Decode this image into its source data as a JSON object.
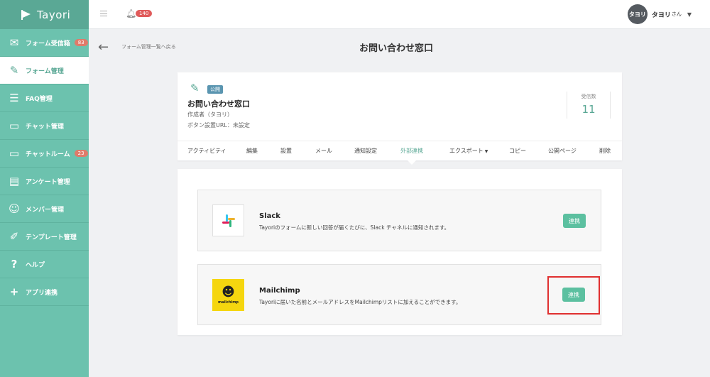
{
  "app": {
    "name": "Tayori"
  },
  "sidebar": {
    "items": [
      {
        "label": "フォーム受信箱",
        "badge": "83",
        "icon": "inbox-icon",
        "glyph": "✉"
      },
      {
        "label": "フォーム管理",
        "badge": "",
        "icon": "form-edit-icon",
        "glyph": "✎"
      },
      {
        "label": "FAQ管理",
        "badge": "",
        "icon": "faq-icon",
        "glyph": "☰"
      },
      {
        "label": "チャット管理",
        "badge": "",
        "icon": "chat-icon",
        "glyph": "▭"
      },
      {
        "label": "チャットルーム",
        "badge": "23",
        "icon": "chat-room-icon",
        "glyph": "▭"
      },
      {
        "label": "アンケート管理",
        "badge": "",
        "icon": "survey-icon",
        "glyph": "▤"
      },
      {
        "label": "メンバー管理",
        "badge": "",
        "icon": "members-icon",
        "glyph": "☺"
      },
      {
        "label": "テンプレート管理",
        "badge": "",
        "icon": "template-icon",
        "glyph": "✐"
      },
      {
        "label": "ヘルプ",
        "badge": "",
        "icon": "help-icon",
        "glyph": "?"
      },
      {
        "label": "アプリ連携",
        "badge": "",
        "icon": "app-integration-icon",
        "glyph": "+"
      }
    ]
  },
  "topbar": {
    "notification_count": "140",
    "user": {
      "avatar_text": "タヨリ",
      "name": "タヨリ",
      "suffix": "さん"
    }
  },
  "header": {
    "back_label": "フォーム管理一覧へ戻る",
    "title": "お問い合わせ窓口"
  },
  "form": {
    "status_badge": "公開",
    "name": "お問い合わせ窓口",
    "author": "作成者（タヨリ）",
    "button_url": "ボタン設置URL：未設定",
    "received_label": "受信数",
    "received_count": "11"
  },
  "tabs": [
    {
      "label": "アクティビティ"
    },
    {
      "label": "編集"
    },
    {
      "label": "設置"
    },
    {
      "label": "メール"
    },
    {
      "label": "通知設定"
    },
    {
      "label": "外部連携",
      "active": true
    },
    {
      "label": "エクスポート"
    },
    {
      "label": "コピー"
    },
    {
      "label": "公開ページ"
    },
    {
      "label": "削除"
    }
  ],
  "integrations": [
    {
      "name": "Slack",
      "description": "Tayoriのフォームに新しい回答が届くたびに、Slack チャネルに通知されます。",
      "button_label": "連携",
      "logo": "slack-logo"
    },
    {
      "name": "Mailchimp",
      "description": "Tayoriに届いた名前とメールアドレスをMailchimpリストに加えることができます。",
      "button_label": "連携",
      "logo": "mailchimp-logo",
      "logo_text": "mailchimp"
    }
  ],
  "colors": {
    "sidebar": "#6cc2ae",
    "accent": "#5aa895",
    "button": "#5cc0a0",
    "highlight": "#e03030",
    "badge": "#e07a6a"
  }
}
